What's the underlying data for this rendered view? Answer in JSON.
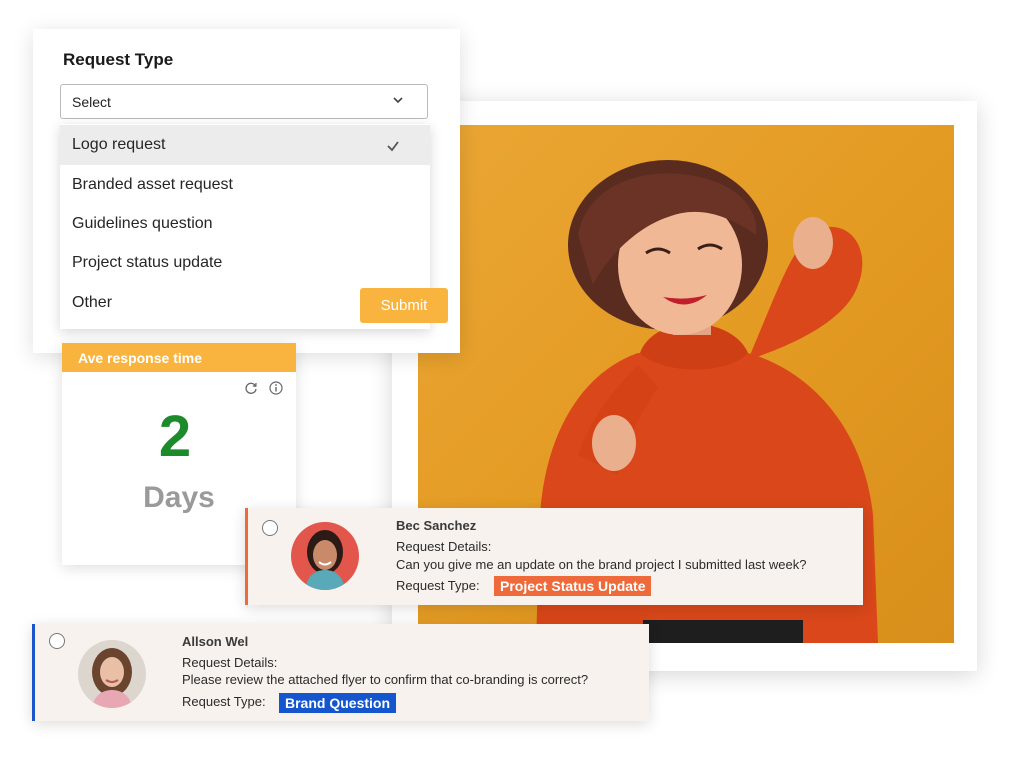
{
  "request_form": {
    "title": "Request Type",
    "select_value": "Select",
    "options": [
      {
        "label": "Logo request",
        "selected": true
      },
      {
        "label": "Branded asset request",
        "selected": false
      },
      {
        "label": "Guidelines question",
        "selected": false
      },
      {
        "label": "Project status update",
        "selected": false
      },
      {
        "label": "Other",
        "selected": false
      }
    ],
    "submit_label": "Submit"
  },
  "metric": {
    "title": "Ave response time",
    "value": "2",
    "unit": "Days"
  },
  "requests": [
    {
      "name": "Bec Sanchez",
      "details_label": "Request Details:",
      "details": "Can you give me an update on the brand project I submitted last week?",
      "type_label": "Request Type:",
      "type": "Project Status Update",
      "type_color": "#ef6a3a"
    },
    {
      "name": "Allson Wel",
      "details_label": "Request Details:",
      "details": "Please review the attached flyer to confirm that co-branding is correct?",
      "type_label": "Request Type:",
      "type": "Brand Question",
      "type_color": "#1556cf"
    }
  ],
  "colors": {
    "accent": "#f9b43f",
    "metric_value": "#1d8a2b",
    "photo_background": "#e39a22"
  },
  "icons": [
    "chevron-down-icon",
    "checkmark-icon",
    "refresh-icon",
    "info-icon"
  ]
}
